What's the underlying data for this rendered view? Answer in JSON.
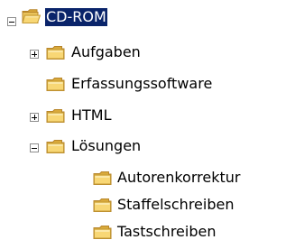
{
  "tree": {
    "root": {
      "label": "CD-ROM",
      "expanded": true,
      "selected": true,
      "icon": "folder-open-icon"
    },
    "aufgaben": {
      "label": "Aufgaben",
      "expanded": false,
      "icon": "folder-icon"
    },
    "erfassungssoftware": {
      "label": "Erfassungssoftware",
      "icon": "folder-icon"
    },
    "html": {
      "label": "HTML",
      "expanded": false,
      "icon": "folder-icon"
    },
    "loesungen": {
      "label": "Lösungen",
      "expanded": true,
      "icon": "folder-icon"
    },
    "autorenkorrektur": {
      "label": "Autorenkorrektur",
      "icon": "folder-icon"
    },
    "staffelschreiben": {
      "label": "Staffelschreiben",
      "icon": "folder-icon"
    },
    "tastschreiben": {
      "label": "Tastschreiben",
      "icon": "folder-icon"
    }
  },
  "colors": {
    "selection_bg": "#0a246a",
    "selection_text": "#ffffff",
    "folder_fill": "#f8d775",
    "folder_dark": "#d9a93a",
    "toggle_border": "#8c8c8c"
  }
}
